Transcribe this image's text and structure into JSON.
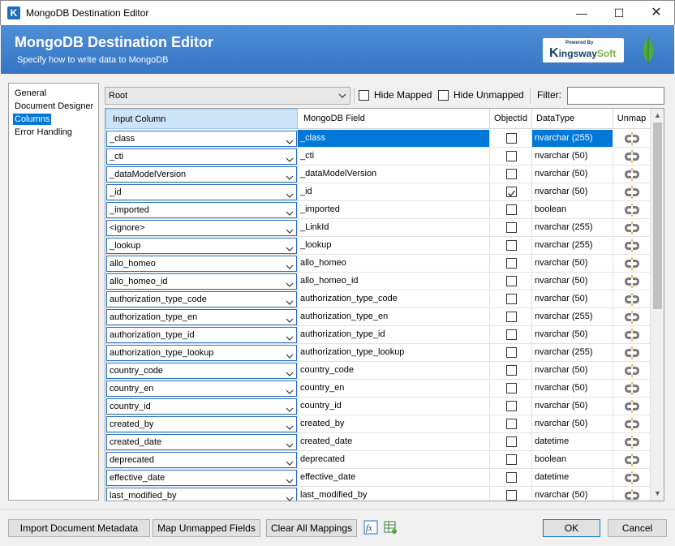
{
  "window": {
    "title": "MongoDB Destination Editor",
    "logo_letter": "K",
    "minimize_glyph": "—",
    "maximize_glyph": "☐",
    "close_glyph": "✕"
  },
  "header": {
    "title": "MongoDB Destination Editor",
    "subtitle": "Specify how to write data to MongoDB",
    "brand_powered": "Powered By",
    "brand_k": "K",
    "brand_ingsway": "ingsway",
    "brand_soft": "Soft"
  },
  "nav": {
    "items": [
      "General",
      "Document Designer",
      "Columns",
      "Error Handling"
    ],
    "selected_index": 2
  },
  "toolbar": {
    "root_value": "Root",
    "hide_mapped_label": "Hide Mapped",
    "hide_unmapped_label": "Hide Unmapped",
    "filter_label": "Filter:",
    "filter_value": ""
  },
  "grid": {
    "headers": {
      "input_column": "Input Column",
      "mongo_field": "MongoDB Field",
      "object_id": "ObjectId",
      "data_type": "DataType",
      "unmap": "Unmap"
    },
    "rows": [
      {
        "input": "_class",
        "field": "_class",
        "objectid": false,
        "type": "nvarchar (255)"
      },
      {
        "input": "_cti",
        "field": "_cti",
        "objectid": false,
        "type": "nvarchar (50)"
      },
      {
        "input": "_dataModelVersion",
        "field": "_dataModelVersion",
        "objectid": false,
        "type": "nvarchar (50)"
      },
      {
        "input": "_id",
        "field": "_id",
        "objectid": true,
        "type": "nvarchar (50)"
      },
      {
        "input": "_imported",
        "field": "_imported",
        "objectid": false,
        "type": "boolean"
      },
      {
        "input": "<ignore>",
        "field": "_LinkId",
        "objectid": false,
        "type": "nvarchar (255)"
      },
      {
        "input": "_lookup",
        "field": "_lookup",
        "objectid": false,
        "type": "nvarchar (255)"
      },
      {
        "input": "allo_homeo",
        "field": "allo_homeo",
        "objectid": false,
        "type": "nvarchar (50)"
      },
      {
        "input": "allo_homeo_id",
        "field": "allo_homeo_id",
        "objectid": false,
        "type": "nvarchar (50)"
      },
      {
        "input": "authorization_type_code",
        "field": "authorization_type_code",
        "objectid": false,
        "type": "nvarchar (50)"
      },
      {
        "input": "authorization_type_en",
        "field": "authorization_type_en",
        "objectid": false,
        "type": "nvarchar (255)"
      },
      {
        "input": "authorization_type_id",
        "field": "authorization_type_id",
        "objectid": false,
        "type": "nvarchar (50)"
      },
      {
        "input": "authorization_type_lookup",
        "field": "authorization_type_lookup",
        "objectid": false,
        "type": "nvarchar (255)"
      },
      {
        "input": "country_code",
        "field": "country_code",
        "objectid": false,
        "type": "nvarchar (50)"
      },
      {
        "input": "country_en",
        "field": "country_en",
        "objectid": false,
        "type": "nvarchar (50)"
      },
      {
        "input": "country_id",
        "field": "country_id",
        "objectid": false,
        "type": "nvarchar (50)"
      },
      {
        "input": "created_by",
        "field": "created_by",
        "objectid": false,
        "type": "nvarchar (50)"
      },
      {
        "input": "created_date",
        "field": "created_date",
        "objectid": false,
        "type": "datetime"
      },
      {
        "input": "deprecated",
        "field": "deprecated",
        "objectid": false,
        "type": "boolean"
      },
      {
        "input": "effective_date",
        "field": "effective_date",
        "objectid": false,
        "type": "datetime"
      },
      {
        "input": "last_modified_by",
        "field": "last_modified_by",
        "objectid": false,
        "type": "nvarchar (50)"
      }
    ],
    "selected_row": 0
  },
  "buttons": {
    "import_metadata": "Import Document Metadata",
    "map_unmapped": "Map Unmapped Fields",
    "clear_mappings": "Clear All Mappings",
    "ok": "OK",
    "cancel": "Cancel"
  },
  "colors": {
    "header_blue": "#3a7dc9",
    "selection_blue": "#0078d7",
    "brand_green": "#7cb342",
    "mongo_green": "#4faa41"
  }
}
